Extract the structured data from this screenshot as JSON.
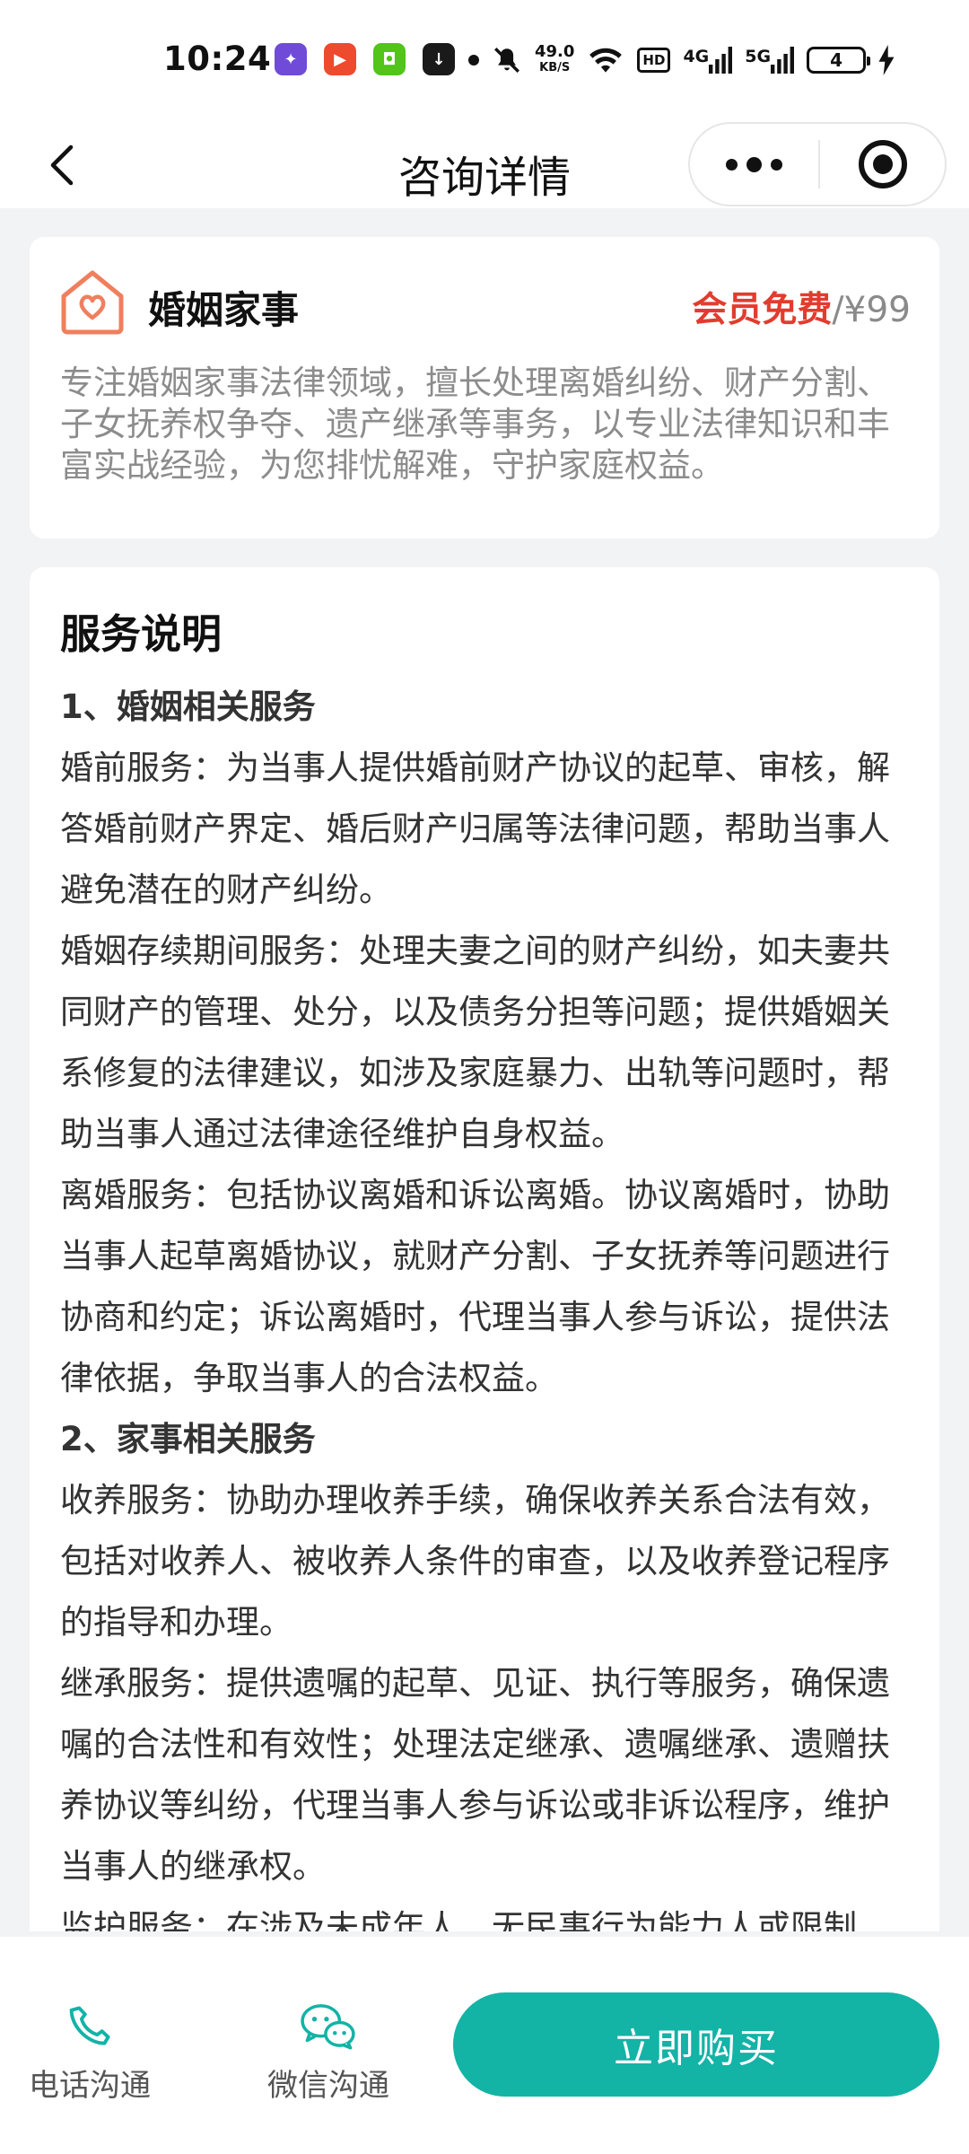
{
  "status_bar": {
    "time": "10:24",
    "net_speed_value": "49.0",
    "net_speed_unit": "KB/S",
    "hd_badge": "HD",
    "net_1": "4G",
    "net_2": "5G",
    "battery": "4"
  },
  "nav": {
    "title": "咨询详情"
  },
  "service_card": {
    "title": "婚姻家事",
    "member_price": "会员免费",
    "price": "/¥99",
    "description": "专注婚姻家事法律领域，擅长处理离婚纠纷、财产分割、子女抚养权争夺、遗产继承等事务，以专业法律知识和丰富实战经验，为您排忧解难，守护家庭权益。"
  },
  "service_detail": {
    "heading": "服务说明",
    "section_1_title": "1、婚姻相关服务",
    "p1": "婚前服务：为当事人提供婚前财产协议的起草、审核，解答婚前财产界定、婚后财产归属等法律问题，帮助当事人避免潜在的财产纠纷。",
    "p2": "婚姻存续期间服务：处理夫妻之间的财产纠纷，如夫妻共同财产的管理、处分，以及债务分担等问题；提供婚姻关系修复的法律建议，如涉及家庭暴力、出轨等问题时，帮助当事人通过法律途径维护自身权益。",
    "p3": "离婚服务：包括协议离婚和诉讼离婚。协议离婚时，协助当事人起草离婚协议，就财产分割、子女抚养等问题进行协商和约定；诉讼离婚时，代理当事人参与诉讼，提供法律依据，争取当事人的合法权益。",
    "section_2_title": "2、家事相关服务",
    "p4": "收养服务：协助办理收养手续，确保收养关系合法有效，包括对收养人、被收养人条件的审查，以及收养登记程序的指导和办理。",
    "p5": "继承服务：提供遗嘱的起草、见证、执行等服务，确保遗嘱的合法性和有效性；处理法定继承、遗嘱继承、遗赠扶养协议等纠纷，代理当事人参与诉讼或非诉讼程序，维护当事人的继承权。",
    "p6": "监护服务：在涉及未成年人、无民事行为能力人或限制"
  },
  "bottom_bar": {
    "phone_label": "电话沟通",
    "wechat_label": "微信沟通",
    "buy_label": "立即购买"
  },
  "colors": {
    "accent": "#13b3a6",
    "price_red": "#e23c2e",
    "icon_orange": "#ef7f5e"
  }
}
